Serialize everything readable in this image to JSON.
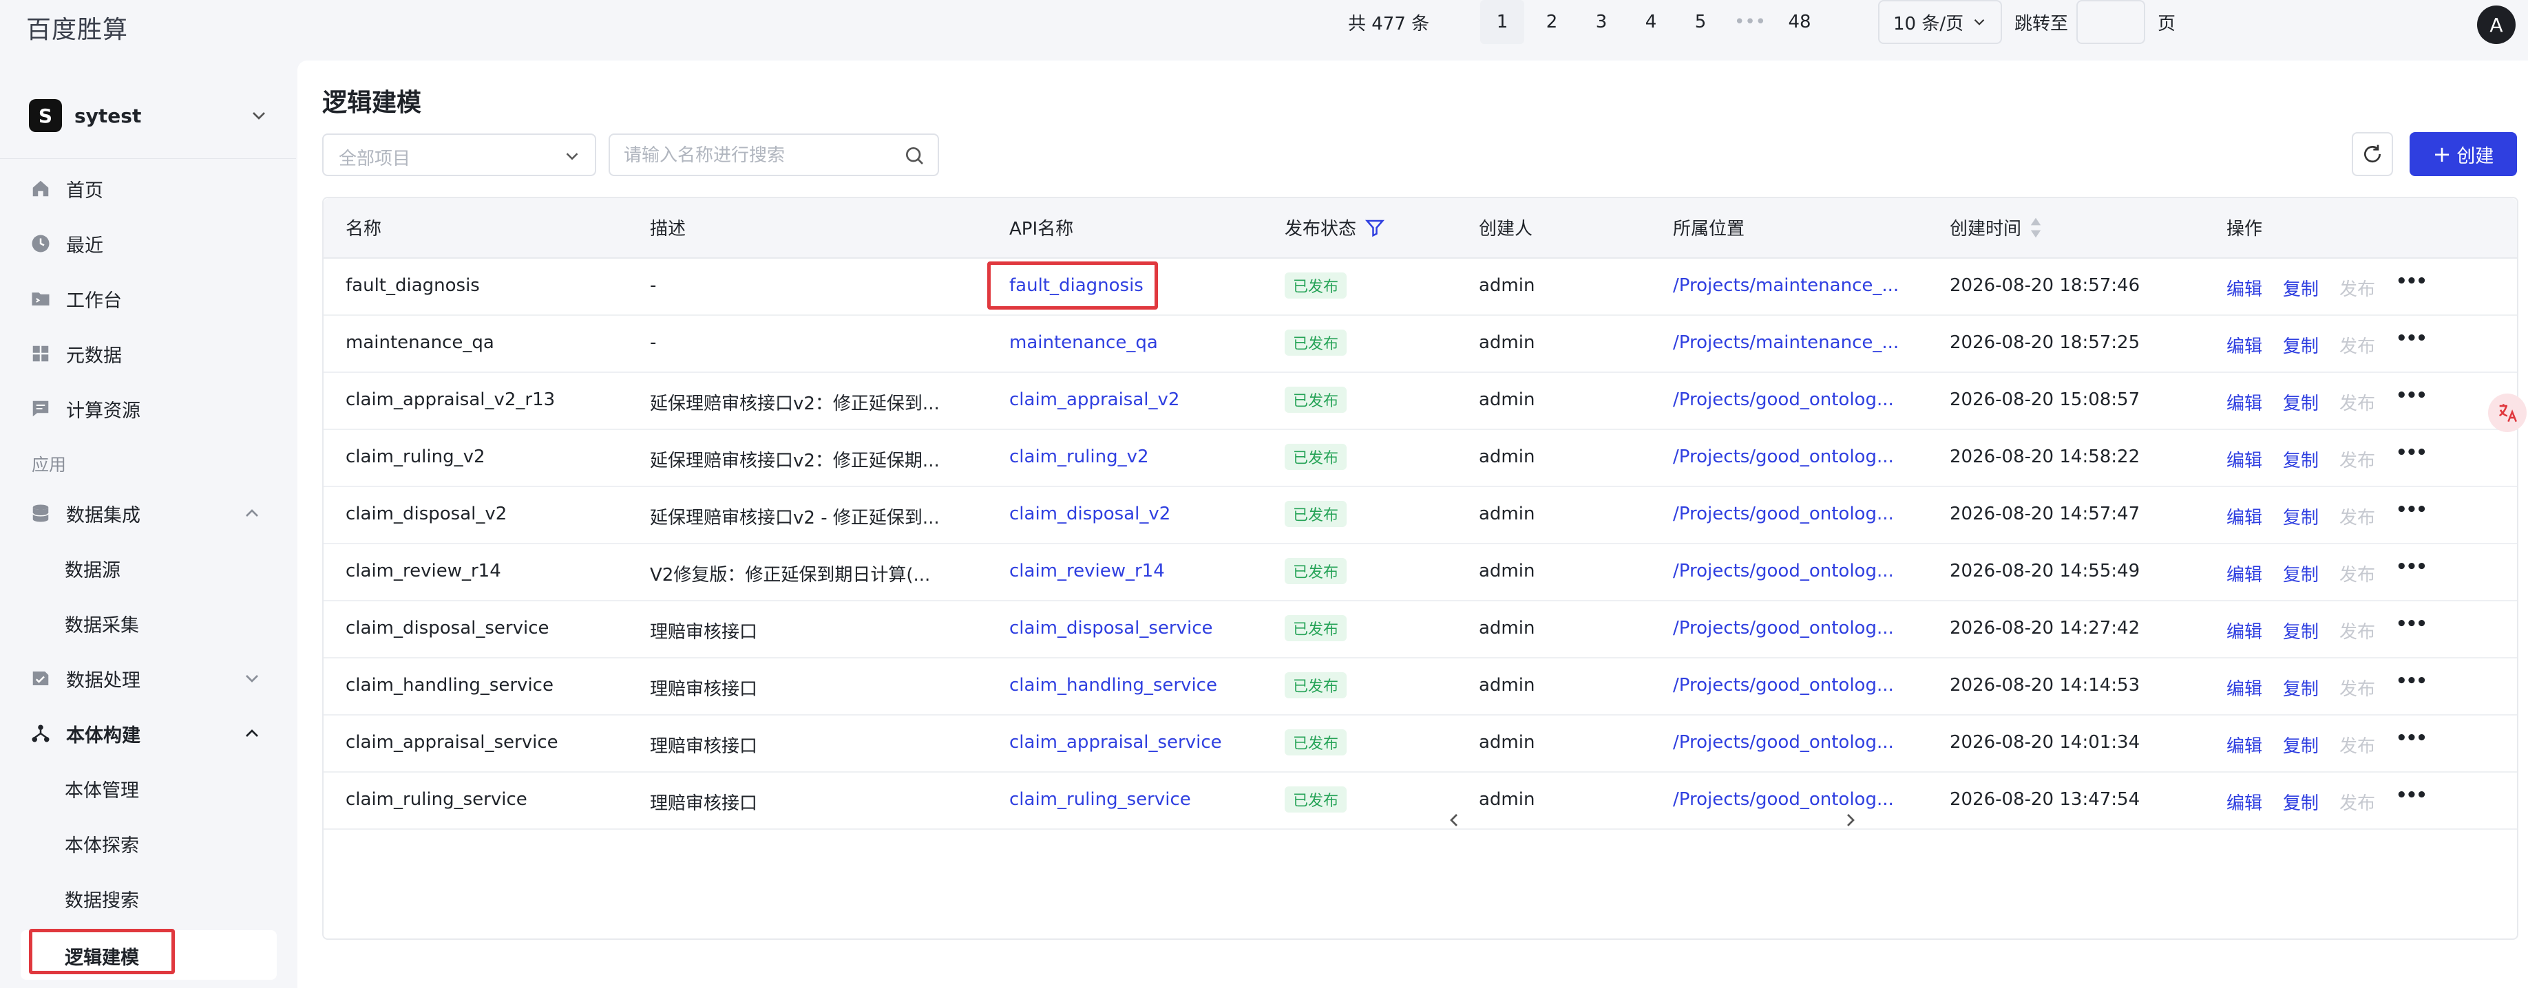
{
  "app": {
    "title": "百度胜算",
    "user_initial": "A"
  },
  "workspace": {
    "logo": "S",
    "name": "sytest"
  },
  "sidebar": {
    "items": [
      {
        "label": "首页",
        "icon": "home-icon"
      },
      {
        "label": "最近",
        "icon": "clock-icon"
      },
      {
        "label": "工作台",
        "icon": "terminal-folder-icon"
      },
      {
        "label": "元数据",
        "icon": "grid-icon"
      },
      {
        "label": "计算资源",
        "icon": "message-icon"
      }
    ],
    "group_label": "应用",
    "groups": [
      {
        "label": "数据集成",
        "icon": "database-icon",
        "expanded": true,
        "children": [
          "数据源",
          "数据采集"
        ]
      },
      {
        "label": "数据处理",
        "icon": "process-icon",
        "expanded": false,
        "children": []
      },
      {
        "label": "本体构建",
        "icon": "ontology-icon",
        "expanded": true,
        "children": [
          "本体管理",
          "本体探索",
          "数据搜索",
          "逻辑建模"
        ]
      }
    ],
    "active": "逻辑建模"
  },
  "main": {
    "title": "逻辑建模",
    "project_select_placeholder": "全部项目",
    "search_placeholder": "请输入名称进行搜索",
    "create_label": "创建"
  },
  "table": {
    "columns": [
      "名称",
      "描述",
      "API名称",
      "发布状态",
      "创建人",
      "所属位置",
      "创建时间",
      "操作"
    ],
    "rows": [
      {
        "name": "fault_diagnosis",
        "desc": "-",
        "api": "fault_diagnosis",
        "status": "已发布",
        "creator": "admin",
        "location": "/Projects/maintenance_...",
        "time": "2026-08-20 18:57:46"
      },
      {
        "name": "maintenance_qa",
        "desc": "-",
        "api": "maintenance_qa",
        "status": "已发布",
        "creator": "admin",
        "location": "/Projects/maintenance_...",
        "time": "2026-08-20 18:57:25"
      },
      {
        "name": "claim_appraisal_v2_r13",
        "desc": "延保理赔审核接口v2：修正延保到...",
        "api": "claim_appraisal_v2",
        "status": "已发布",
        "creator": "admin",
        "location": "/Projects/good_ontolog...",
        "time": "2026-08-20 15:08:57"
      },
      {
        "name": "claim_ruling_v2",
        "desc": "延保理赔审核接口v2：修正延保期...",
        "api": "claim_ruling_v2",
        "status": "已发布",
        "creator": "admin",
        "location": "/Projects/good_ontolog...",
        "time": "2026-08-20 14:58:22"
      },
      {
        "name": "claim_disposal_v2",
        "desc": "延保理赔审核接口v2 - 修正延保到...",
        "api": "claim_disposal_v2",
        "status": "已发布",
        "creator": "admin",
        "location": "/Projects/good_ontolog...",
        "time": "2026-08-20 14:57:47"
      },
      {
        "name": "claim_review_r14",
        "desc": "V2修复版：修正延保到期日计算(...",
        "api": "claim_review_r14",
        "status": "已发布",
        "creator": "admin",
        "location": "/Projects/good_ontolog...",
        "time": "2026-08-20 14:55:49"
      },
      {
        "name": "claim_disposal_service",
        "desc": "理赔审核接口",
        "api": "claim_disposal_service",
        "status": "已发布",
        "creator": "admin",
        "location": "/Projects/good_ontolog...",
        "time": "2026-08-20 14:27:42"
      },
      {
        "name": "claim_handling_service",
        "desc": "理赔审核接口",
        "api": "claim_handling_service",
        "status": "已发布",
        "creator": "admin",
        "location": "/Projects/good_ontolog...",
        "time": "2026-08-20 14:14:53"
      },
      {
        "name": "claim_appraisal_service",
        "desc": "理赔审核接口",
        "api": "claim_appraisal_service",
        "status": "已发布",
        "creator": "admin",
        "location": "/Projects/good_ontolog...",
        "time": "2026-08-20 14:01:34"
      },
      {
        "name": "claim_ruling_service",
        "desc": "理赔审核接口",
        "api": "claim_ruling_service",
        "status": "已发布",
        "creator": "admin",
        "location": "/Projects/good_ontolog...",
        "time": "2026-08-20 13:47:54"
      }
    ],
    "actions": {
      "edit": "编辑",
      "copy": "复制",
      "publish": "发布",
      "more": "•••"
    }
  },
  "pagination": {
    "total": "共 477 条",
    "pages": [
      "1",
      "2",
      "3",
      "4",
      "5",
      "•••",
      "48"
    ],
    "current": "1",
    "page_size": "10 条/页",
    "jump_label": "跳转至",
    "jump_suffix": "页"
  },
  "colors": {
    "accent": "#2f3fe0",
    "highlight": "#e0383e",
    "published_bg": "#e7f7ec",
    "published_text": "#26a357"
  }
}
